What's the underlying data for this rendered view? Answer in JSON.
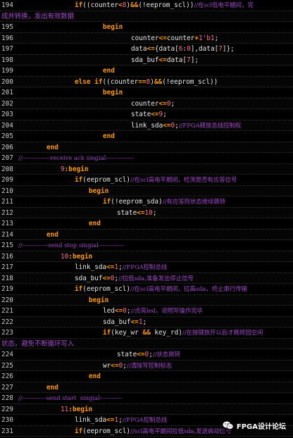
{
  "watermark": {
    "icon": "wechat-icon",
    "text": "FPGA设计论坛"
  },
  "colors": {
    "keyword": "#ff9900",
    "comment": "#a247c9",
    "number": "#ff6a8a",
    "identifier": "#e8e8e8",
    "line_number": "#c8c8c8"
  },
  "lines": [
    {
      "n": "194",
      "indent": 2,
      "tokens": [
        [
          "kw",
          "if"
        ],
        [
          "id",
          "(("
        ],
        [
          "id",
          "counter"
        ],
        [
          "op",
          "<"
        ],
        [
          "num",
          "8"
        ],
        [
          "id",
          ")"
        ],
        [
          "op",
          "&&"
        ],
        [
          "id",
          "(!"
        ],
        [
          "id",
          "eeprom_scl"
        ],
        [
          "id",
          "))"
        ],
        [
          "cmt",
          "//在scl低电平期间，完"
        ]
      ]
    },
    {
      "n": "",
      "indent": 0,
      "tokens": [
        [
          "cont",
          "成并转换，发出有效数据"
        ]
      ]
    },
    {
      "n": "195",
      "indent": 3,
      "tokens": [
        [
          "kw",
          "begin"
        ]
      ]
    },
    {
      "n": "196",
      "indent": 4,
      "tokens": [
        [
          "id",
          "counter"
        ],
        [
          "op",
          "<="
        ],
        [
          "id",
          "counter"
        ],
        [
          "op",
          "+"
        ],
        [
          "num",
          "1'b1"
        ],
        [
          "id",
          ";"
        ]
      ]
    },
    {
      "n": "197",
      "indent": 4,
      "tokens": [
        [
          "id",
          "data"
        ],
        [
          "op",
          "<="
        ],
        [
          "id",
          "{data["
        ],
        [
          "num",
          "6"
        ],
        [
          "id",
          ":"
        ],
        [
          "num",
          "0"
        ],
        [
          "id",
          "],data["
        ],
        [
          "num",
          "7"
        ],
        [
          "id",
          "]};"
        ]
      ]
    },
    {
      "n": "198",
      "indent": 4,
      "tokens": [
        [
          "id",
          "sda_buf"
        ],
        [
          "op",
          "<="
        ],
        [
          "id",
          "data["
        ],
        [
          "num",
          "7"
        ],
        [
          "id",
          "];"
        ]
      ]
    },
    {
      "n": "199",
      "indent": 3,
      "tokens": [
        [
          "kw",
          "end"
        ]
      ]
    },
    {
      "n": "200",
      "indent": 2,
      "tokens": [
        [
          "kw",
          "else if"
        ],
        [
          "id",
          "(("
        ],
        [
          "id",
          "counter"
        ],
        [
          "op",
          "=="
        ],
        [
          "num",
          "8"
        ],
        [
          "id",
          ")"
        ],
        [
          "op",
          "&&"
        ],
        [
          "id",
          "(!"
        ],
        [
          "id",
          "eeprom_scl"
        ],
        [
          "id",
          "))"
        ]
      ]
    },
    {
      "n": "201",
      "indent": 3,
      "tokens": [
        [
          "kw",
          "begin"
        ]
      ]
    },
    {
      "n": "202",
      "indent": 4,
      "tokens": [
        [
          "id",
          "counter"
        ],
        [
          "op",
          "<="
        ],
        [
          "num",
          "0"
        ],
        [
          "id",
          ";"
        ]
      ]
    },
    {
      "n": "203",
      "indent": 4,
      "tokens": [
        [
          "id",
          "state"
        ],
        [
          "op",
          "<="
        ],
        [
          "num",
          "9"
        ],
        [
          "id",
          ";"
        ]
      ]
    },
    {
      "n": "204",
      "indent": 4,
      "tokens": [
        [
          "id",
          "link_sda"
        ],
        [
          "op",
          "<="
        ],
        [
          "num",
          "0"
        ],
        [
          "id",
          ";"
        ],
        [
          "cmt",
          "//FPGA释放总线控制权"
        ]
      ]
    },
    {
      "n": "205",
      "indent": 3,
      "tokens": [
        [
          "kw",
          "end"
        ]
      ]
    },
    {
      "n": "206",
      "indent": 1,
      "tokens": [
        [
          "kw",
          "end"
        ]
      ]
    },
    {
      "n": "207",
      "indent": 0,
      "tokens": [
        [
          "cmt",
          "//--------------receive ack singial--------------"
        ]
      ]
    },
    {
      "n": "208",
      "indent": 1.5,
      "tokens": [
        [
          "num",
          "9"
        ],
        [
          "kw",
          ":begin"
        ]
      ]
    },
    {
      "n": "209",
      "indent": 2,
      "tokens": [
        [
          "kw",
          "if"
        ],
        [
          "id",
          "(eeprom_scl)"
        ],
        [
          "cmt",
          "//在scl高电平期间，检测是否有应答信号"
        ]
      ]
    },
    {
      "n": "210",
      "indent": 2.5,
      "tokens": [
        [
          "kw",
          "begin"
        ]
      ]
    },
    {
      "n": "211",
      "indent": 3,
      "tokens": [
        [
          "kw",
          "if"
        ],
        [
          "id",
          "(!eeprom_sda)"
        ],
        [
          "cmt",
          "//有应答则状态继续跳转"
        ]
      ]
    },
    {
      "n": "212",
      "indent": 3.5,
      "tokens": [
        [
          "id",
          "state"
        ],
        [
          "op",
          "<="
        ],
        [
          "num",
          "10"
        ],
        [
          "id",
          ";"
        ]
      ]
    },
    {
      "n": "213",
      "indent": 2.5,
      "tokens": [
        [
          "kw",
          "end"
        ]
      ]
    },
    {
      "n": "214",
      "indent": 1,
      "tokens": [
        [
          "kw",
          "end"
        ]
      ]
    },
    {
      "n": "215",
      "indent": 0,
      "tokens": [
        [
          "cmt",
          "//-------------send stop singial-------------"
        ]
      ]
    },
    {
      "n": "216",
      "indent": 1.5,
      "tokens": [
        [
          "num",
          "10"
        ],
        [
          "kw",
          ":begin"
        ]
      ]
    },
    {
      "n": "217",
      "indent": 2,
      "tokens": [
        [
          "id",
          "link_sda"
        ],
        [
          "op",
          "<="
        ],
        [
          "num",
          "1"
        ],
        [
          "id",
          ";"
        ],
        [
          "cmt",
          "//FPGA控制总线"
        ]
      ]
    },
    {
      "n": "218",
      "indent": 2,
      "tokens": [
        [
          "id",
          "sda_buf"
        ],
        [
          "op",
          "<="
        ],
        [
          "num",
          "0"
        ],
        [
          "id",
          ";"
        ],
        [
          "cmt",
          "//拉低sda,准备发出停止信号"
        ]
      ]
    },
    {
      "n": "219",
      "indent": 2,
      "tokens": [
        [
          "kw",
          "if"
        ],
        [
          "id",
          "(eeprom_scl)"
        ],
        [
          "cmt",
          "//在scl高电平期间，拉高sda，终止串行传输"
        ]
      ]
    },
    {
      "n": "220",
      "indent": 2.5,
      "tokens": [
        [
          "kw",
          "begin"
        ]
      ]
    },
    {
      "n": "221",
      "indent": 3,
      "tokens": [
        [
          "id",
          "led"
        ],
        [
          "op",
          "<="
        ],
        [
          "num",
          "0"
        ],
        [
          "id",
          ";"
        ],
        [
          "cmt",
          "//点亮led，说明写操作完毕"
        ]
      ]
    },
    {
      "n": "222",
      "indent": 3,
      "tokens": [
        [
          "id",
          "sda_buf"
        ],
        [
          "op",
          "<="
        ],
        [
          "num",
          "1"
        ],
        [
          "id",
          ";"
        ]
      ]
    },
    {
      "n": "223",
      "indent": 3,
      "tokens": [
        [
          "kw",
          "if"
        ],
        [
          "id",
          "(key_wr "
        ],
        [
          "op",
          "&&"
        ],
        [
          "id",
          " key_rd)"
        ],
        [
          "cmt",
          "//在按键放开以后才跳转回空闲"
        ]
      ]
    },
    {
      "n": "",
      "indent": 0,
      "tokens": [
        [
          "cont",
          "状态，避免不断循环写入"
        ]
      ]
    },
    {
      "n": "224",
      "indent": 3.5,
      "tokens": [
        [
          "id",
          "state"
        ],
        [
          "op",
          "<="
        ],
        [
          "num",
          "0"
        ],
        [
          "id",
          ";"
        ],
        [
          "cmt",
          "//状态跳转"
        ]
      ]
    },
    {
      "n": "225",
      "indent": 3,
      "tokens": [
        [
          "id",
          "wr"
        ],
        [
          "op",
          "<="
        ],
        [
          "num",
          "0"
        ],
        [
          "id",
          ";"
        ],
        [
          "cmt",
          "//清除写控制标志"
        ]
      ]
    },
    {
      "n": "226",
      "indent": 2.5,
      "tokens": [
        [
          "kw",
          "end"
        ]
      ]
    },
    {
      "n": "227",
      "indent": 1,
      "tokens": [
        [
          "kw",
          "end"
        ]
      ]
    },
    {
      "n": "228",
      "indent": 0,
      "tokens": [
        [
          "cmt",
          "//------------send start  singial-----------"
        ]
      ]
    },
    {
      "n": "229",
      "indent": 1.5,
      "tokens": [
        [
          "num",
          "11"
        ],
        [
          "kw",
          ":begin"
        ]
      ]
    },
    {
      "n": "230",
      "indent": 2,
      "tokens": [
        [
          "id",
          "link_sda"
        ],
        [
          "op",
          "<="
        ],
        [
          "num",
          "1"
        ],
        [
          "id",
          ";"
        ],
        [
          "cmt",
          "//FPGA控制总线"
        ]
      ]
    },
    {
      "n": "231",
      "indent": 2,
      "tokens": [
        [
          "kw",
          "if"
        ],
        [
          "id",
          "(eeprom_scl)"
        ],
        [
          "cmt",
          "//scl高电平期间拉低sda,发送启动信号"
        ]
      ]
    }
  ]
}
